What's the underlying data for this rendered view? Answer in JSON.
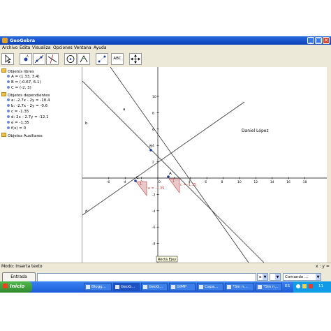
{
  "window": {
    "title": "GeoGebra",
    "min": "_",
    "max": "□",
    "close": "✕"
  },
  "menu": [
    "Archivo",
    "Edita",
    "Visualiza",
    "Opciones",
    "Ventana",
    "Ayuda"
  ],
  "toolbar": {
    "text_tool": "ABC"
  },
  "sidebar": {
    "free_header": "Objetos libres",
    "free": [
      "A = (1.33, 3.4)",
      "B = (-0.67, 6.1)",
      "C = (-2, 3)"
    ],
    "dep_header": "Objetos dependientes",
    "dep": [
      "a: -2.7x - 2y = -10.4",
      "b: -2.7x - 2y = -0.6",
      "c = -1.35",
      "d: 2x - 2.7y = -12.1",
      "e = -1.35",
      "f(x) = 0"
    ],
    "aux_header": "Objetos Auxiliares"
  },
  "canvas": {
    "author": "Daniel López",
    "line_labels": {
      "a": "a",
      "b": "b",
      "d": "d"
    },
    "points": {
      "A": "A",
      "B": "B",
      "C": "C"
    },
    "slope_c_label": "c = -1.35",
    "slope_e_label": "e = -1.35",
    "slope_one": "1",
    "tooltip": "Recta Ejey",
    "x_ticks": [
      "-6",
      "-4",
      "-2",
      "0",
      "2",
      "4",
      "6",
      "8",
      "10",
      "12",
      "14",
      "16",
      "18"
    ],
    "y_ticks": [
      "10",
      "8",
      "6",
      "4",
      "2",
      "-2",
      "-4",
      "-6",
      "-8"
    ]
  },
  "status": {
    "mode": "Modo: Inserta texto",
    "coords": "x : y ="
  },
  "input": {
    "entrada": "Entrada",
    "sym1": "α",
    "comandos": "Comando ..."
  },
  "taskbar": {
    "start": "Inicio",
    "tasks": [
      "Blogg...",
      "GeoG...",
      "GeoG...",
      "GIMP",
      "Capa...",
      "*Sin n...",
      "*Sin n..."
    ],
    "lang": "ES",
    "clock": "11"
  },
  "colors": {
    "titlebar": "#0a3fb8",
    "slope_fill": "#e8c8c8",
    "slope_stroke": "#c04040",
    "point": "#2040a0"
  }
}
